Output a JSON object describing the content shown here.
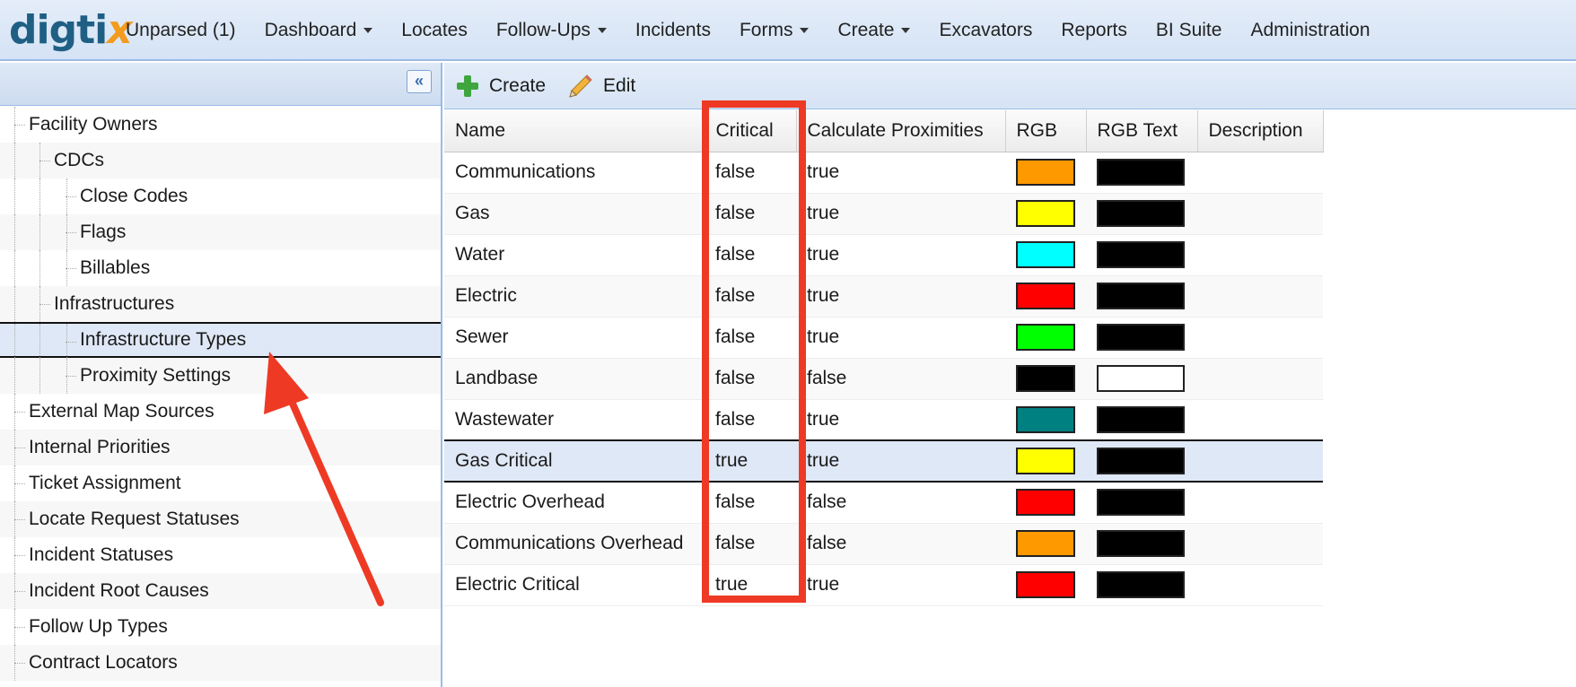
{
  "logo": {
    "part1": "digti",
    "part2": "x"
  },
  "nav": [
    {
      "label": "Unparsed (1)",
      "dropdown": false
    },
    {
      "label": "Dashboard",
      "dropdown": true
    },
    {
      "label": "Locates",
      "dropdown": false
    },
    {
      "label": "Follow-Ups",
      "dropdown": true
    },
    {
      "label": "Incidents",
      "dropdown": false
    },
    {
      "label": "Forms",
      "dropdown": true
    },
    {
      "label": "Create",
      "dropdown": true
    },
    {
      "label": "Excavators",
      "dropdown": false
    },
    {
      "label": "Reports",
      "dropdown": false
    },
    {
      "label": "BI Suite",
      "dropdown": false
    },
    {
      "label": "Administration",
      "dropdown": false
    }
  ],
  "sidebar": {
    "collapse_glyph": "«",
    "items": [
      {
        "label": "Facility Owners",
        "level": 0
      },
      {
        "label": "CDCs",
        "level": 1
      },
      {
        "label": "Close Codes",
        "level": 2
      },
      {
        "label": "Flags",
        "level": 2
      },
      {
        "label": "Billables",
        "level": 2
      },
      {
        "label": "Infrastructures",
        "level": 1
      },
      {
        "label": "Infrastructure Types",
        "level": 2,
        "selected": true
      },
      {
        "label": "Proximity Settings",
        "level": 2
      },
      {
        "label": "External Map Sources",
        "level": 0
      },
      {
        "label": "Internal Priorities",
        "level": 0
      },
      {
        "label": "Ticket Assignment",
        "level": 0
      },
      {
        "label": "Locate Request Statuses",
        "level": 0
      },
      {
        "label": "Incident Statuses",
        "level": 0
      },
      {
        "label": "Incident Root Causes",
        "level": 0
      },
      {
        "label": "Follow Up Types",
        "level": 0
      },
      {
        "label": "Contract Locators",
        "level": 0
      }
    ]
  },
  "toolbar": {
    "create_label": "Create",
    "edit_label": "Edit"
  },
  "grid": {
    "columns": [
      "Name",
      "Critical",
      "Calculate Proximities",
      "RGB",
      "RGB Text",
      "Description"
    ],
    "rows": [
      {
        "name": "Communications",
        "critical": "false",
        "calc": "true",
        "rgb": "#ff9900",
        "rgb_text": "#000000"
      },
      {
        "name": "Gas",
        "critical": "false",
        "calc": "true",
        "rgb": "#ffff00",
        "rgb_text": "#000000"
      },
      {
        "name": "Water",
        "critical": "false",
        "calc": "true",
        "rgb": "#00ffff",
        "rgb_text": "#000000"
      },
      {
        "name": "Electric",
        "critical": "false",
        "calc": "true",
        "rgb": "#ff0000",
        "rgb_text": "#000000"
      },
      {
        "name": "Sewer",
        "critical": "false",
        "calc": "true",
        "rgb": "#00ff00",
        "rgb_text": "#000000"
      },
      {
        "name": "Landbase",
        "critical": "false",
        "calc": "false",
        "rgb": "#000000",
        "rgb_text": "#ffffff"
      },
      {
        "name": "Wastewater",
        "critical": "false",
        "calc": "true",
        "rgb": "#008080",
        "rgb_text": "#000000"
      },
      {
        "name": "Gas Critical",
        "critical": "true",
        "calc": "true",
        "rgb": "#ffff00",
        "rgb_text": "#000000",
        "selected": true
      },
      {
        "name": "Electric Overhead",
        "critical": "false",
        "calc": "false",
        "rgb": "#ff0000",
        "rgb_text": "#000000"
      },
      {
        "name": "Communications Overhead",
        "critical": "false",
        "calc": "false",
        "rgb": "#ff9900",
        "rgb_text": "#000000"
      },
      {
        "name": "Electric Critical",
        "critical": "true",
        "calc": "true",
        "rgb": "#ff0000",
        "rgb_text": "#000000"
      }
    ]
  },
  "annotation_color": "#ee3a24"
}
